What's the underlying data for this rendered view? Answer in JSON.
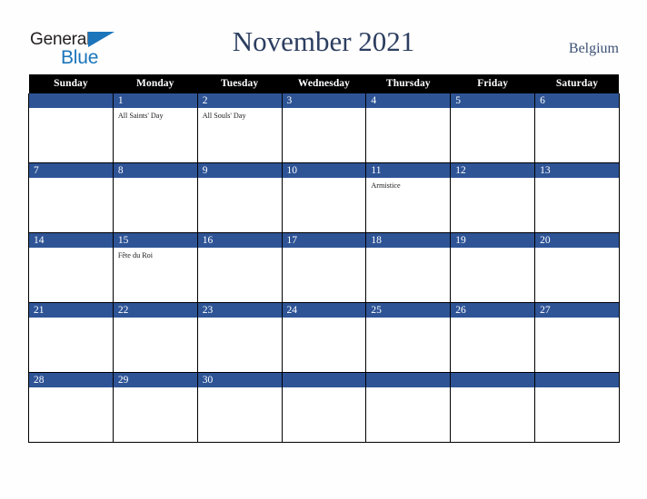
{
  "brand": {
    "name_part1": "General",
    "name_part2": "Blue",
    "triangle_color": "#1b75bb",
    "text_color": "#231f20"
  },
  "header": {
    "title": "November 2021",
    "region": "Belgium",
    "title_color": "#2c3e60"
  },
  "calendar": {
    "month": "November",
    "year": "2021",
    "accent_color": "#2e5496",
    "header_bg": "#000000",
    "weekday_headers": [
      "Sunday",
      "Monday",
      "Tuesday",
      "Wednesday",
      "Thursday",
      "Friday",
      "Saturday"
    ],
    "weeks": [
      [
        {
          "day": "",
          "events": []
        },
        {
          "day": "1",
          "events": [
            "All Saints' Day"
          ]
        },
        {
          "day": "2",
          "events": [
            "All Souls' Day"
          ]
        },
        {
          "day": "3",
          "events": []
        },
        {
          "day": "4",
          "events": []
        },
        {
          "day": "5",
          "events": []
        },
        {
          "day": "6",
          "events": []
        }
      ],
      [
        {
          "day": "7",
          "events": []
        },
        {
          "day": "8",
          "events": []
        },
        {
          "day": "9",
          "events": []
        },
        {
          "day": "10",
          "events": []
        },
        {
          "day": "11",
          "events": [
            "Armistice"
          ]
        },
        {
          "day": "12",
          "events": []
        },
        {
          "day": "13",
          "events": []
        }
      ],
      [
        {
          "day": "14",
          "events": []
        },
        {
          "day": "15",
          "events": [
            "Fête du Roi"
          ]
        },
        {
          "day": "16",
          "events": []
        },
        {
          "day": "17",
          "events": []
        },
        {
          "day": "18",
          "events": []
        },
        {
          "day": "19",
          "events": []
        },
        {
          "day": "20",
          "events": []
        }
      ],
      [
        {
          "day": "21",
          "events": []
        },
        {
          "day": "22",
          "events": []
        },
        {
          "day": "23",
          "events": []
        },
        {
          "day": "24",
          "events": []
        },
        {
          "day": "25",
          "events": []
        },
        {
          "day": "26",
          "events": []
        },
        {
          "day": "27",
          "events": []
        }
      ],
      [
        {
          "day": "28",
          "events": []
        },
        {
          "day": "29",
          "events": []
        },
        {
          "day": "30",
          "events": []
        },
        {
          "day": "",
          "events": []
        },
        {
          "day": "",
          "events": []
        },
        {
          "day": "",
          "events": []
        },
        {
          "day": "",
          "events": []
        }
      ]
    ]
  }
}
